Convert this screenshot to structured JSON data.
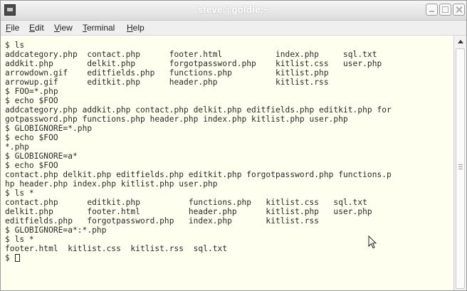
{
  "window": {
    "title": "steve@goldie:~"
  },
  "menu": {
    "file": "File",
    "edit": "Edit",
    "view": "View",
    "terminal": "Terminal",
    "help": "Help"
  },
  "terminal": {
    "lines": [
      "$ ls",
      "addcategory.php  contact.php      footer.html           index.php     sql.txt",
      "addkit.php       delkit.php       forgotpassword.php    kitlist.css   user.php",
      "arrowdown.gif    editfields.php   functions.php         kitlist.php",
      "arrowup.gif      editkit.php      header.php            kitlist.rss",
      "$ FOO=*.php",
      "$ echo $FOO",
      "addcategory.php addkit.php contact.php delkit.php editfields.php editkit.php for",
      "gotpassword.php functions.php header.php index.php kitlist.php user.php",
      "$ GLOBIGNORE=*.php",
      "$ echo $FOO",
      "*.php",
      "$ GLOBIGNORE=a*",
      "$ echo $FOO",
      "contact.php delkit.php editfields.php editkit.php forgotpassword.php functions.p",
      "hp header.php index.php kitlist.php user.php",
      "$ ls *",
      "contact.php      editkit.php          functions.php   kitlist.css   sql.txt",
      "delkit.php       footer.html          header.php      kitlist.php   user.php",
      "editfields.php   forgotpassword.php   index.php       kitlist.rss",
      "$ GLOBIGNORE=a*:*.php",
      "$ ls *",
      "footer.html  kitlist.css  kitlist.rss  sql.txt"
    ],
    "prompt": "$ "
  },
  "icons": {
    "app": "terminal-icon",
    "pointer": "mouse-pointer-icon"
  }
}
